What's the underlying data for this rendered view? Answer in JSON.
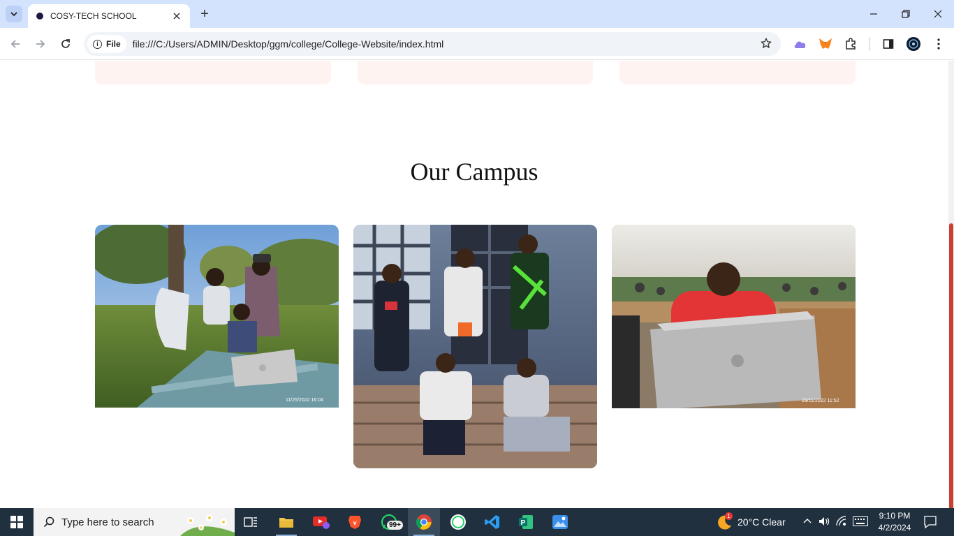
{
  "browser": {
    "tab_title": "COSY-TECH SCHOOL",
    "new_tab_symbol": "+",
    "security_label": "File",
    "url": "file:///C:/Users/ADMIN/Desktop/ggm/college/College-Website/index.html"
  },
  "page": {
    "section_title": "Our Campus",
    "photos": [
      {
        "subject": "three students with a laptop on a bench outdoors",
        "timestamp": "11/25/2022 16:04"
      },
      {
        "subject": "group of five students posing on steps",
        "timestamp": ""
      },
      {
        "subject": "student in red hoodie using a laptop under a tent",
        "timestamp": "29/11/2022 11:52"
      }
    ]
  },
  "taskbar": {
    "search_placeholder": "Type here to search",
    "whatsapp_badge": "99+",
    "weather_badge": "1",
    "weather": "20°C  Clear",
    "time": "9:10 PM",
    "date": "4/2/2024"
  },
  "icons": {
    "tab_search": "chevron-down-icon",
    "close": "close-icon",
    "back": "arrow-left-icon",
    "forward": "arrow-right-icon",
    "reload": "reload-icon",
    "bookmark": "star-icon",
    "extensions": "puzzle-icon",
    "sidepanel": "side-panel-icon",
    "menu": "kebab-menu-icon"
  },
  "colors": {
    "tabstrip": "#d3e3fd",
    "card_stub": "#fff3f2",
    "scrollbar_thumb": "#c94131",
    "taskbar": "#20303f"
  }
}
